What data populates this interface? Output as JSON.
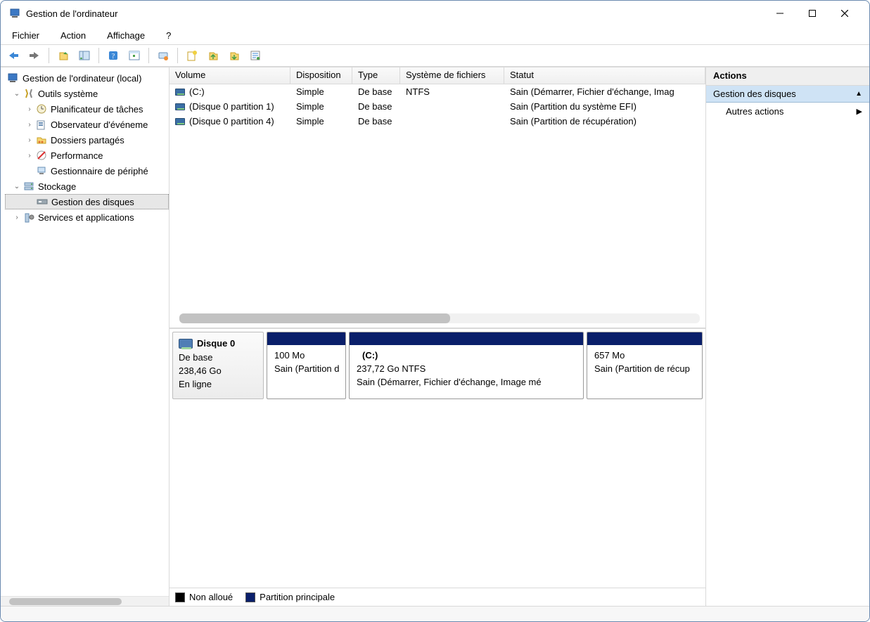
{
  "window": {
    "title": "Gestion de l'ordinateur"
  },
  "menubar": {
    "file": "Fichier",
    "action": "Action",
    "view": "Affichage",
    "help": "?"
  },
  "tree": {
    "root": "Gestion de l'ordinateur (local)",
    "sys": "Outils système",
    "sched": "Planificateur de tâches",
    "event": "Observateur d'événeme",
    "shared": "Dossiers partagés",
    "perf": "Performance",
    "devmgr": "Gestionnaire de périphé",
    "storage": "Stockage",
    "diskmgmt": "Gestion des disques",
    "services": "Services et applications"
  },
  "vol_headers": {
    "volume": "Volume",
    "dispo": "Disposition",
    "type": "Type",
    "fs": "Système de fichiers",
    "status": "Statut"
  },
  "volumes": [
    {
      "name": "(C:)",
      "dispo": "Simple",
      "type": "De base",
      "fs": "NTFS",
      "status": "Sain (Démarrer, Fichier d'échange, Imag"
    },
    {
      "name": "(Disque 0 partition 1)",
      "dispo": "Simple",
      "type": "De base",
      "fs": "",
      "status": "Sain (Partition du système EFI)"
    },
    {
      "name": "(Disque 0 partition 4)",
      "dispo": "Simple",
      "type": "De base",
      "fs": "",
      "status": "Sain (Partition de récupération)"
    }
  ],
  "disk": {
    "label": "Disque 0",
    "kind": "De base",
    "size": "238,46 Go",
    "state": "En ligne",
    "parts": [
      {
        "name": "",
        "size": "100 Mo",
        "status": "Sain (Partition d"
      },
      {
        "name": "(C:)",
        "size": "237,72 Go NTFS",
        "status": "Sain (Démarrer, Fichier d'échange, Image mé"
      },
      {
        "name": "",
        "size": "657 Mo",
        "status": "Sain (Partition de récup"
      }
    ]
  },
  "legend": {
    "unalloc": "Non alloué",
    "primary": "Partition principale"
  },
  "rp": {
    "header": "Actions",
    "section": "Gestion des disques",
    "more": "Autres actions"
  }
}
